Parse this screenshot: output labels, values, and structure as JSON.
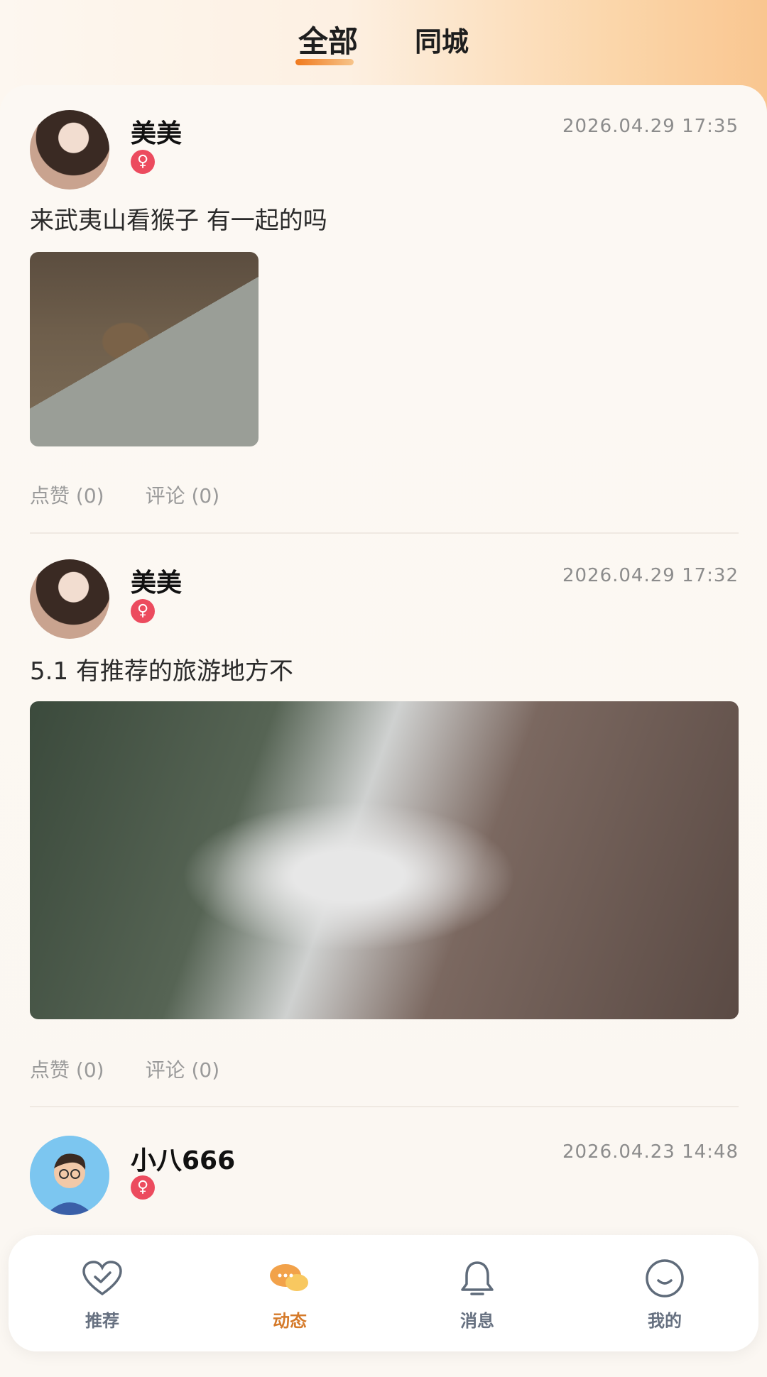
{
  "tabs": [
    {
      "label": "全部",
      "active": true
    },
    {
      "label": "同城",
      "active": false
    }
  ],
  "posts": [
    {
      "username": "美美",
      "gender_symbol": "♀",
      "time": "2026.04.29 17:35",
      "content": "来武夷山看猴子 有一起的吗",
      "like_label": "点赞 (0)",
      "comment_label": "评论 (0)"
    },
    {
      "username": "美美",
      "gender_symbol": "♀",
      "time": "2026.04.29 17:32",
      "content": "5.1 有推荐的旅游地方不",
      "like_label": "点赞 (0)",
      "comment_label": "评论 (0)"
    },
    {
      "username": "小八666",
      "gender_symbol": "♀",
      "time": "2026.04.23 14:48"
    }
  ],
  "nav": [
    {
      "label": "推荐",
      "icon": "heart-check-icon",
      "active": false
    },
    {
      "label": "动态",
      "icon": "chat-bubble-icon",
      "active": true
    },
    {
      "label": "消息",
      "icon": "bell-icon",
      "active": false
    },
    {
      "label": "我的",
      "icon": "smile-icon",
      "active": false
    }
  ],
  "colors": {
    "accent": "#f07a1e",
    "gender_badge": "#ec4b5e",
    "nav_active": "#d57a2a",
    "nav_inactive": "#667080"
  }
}
